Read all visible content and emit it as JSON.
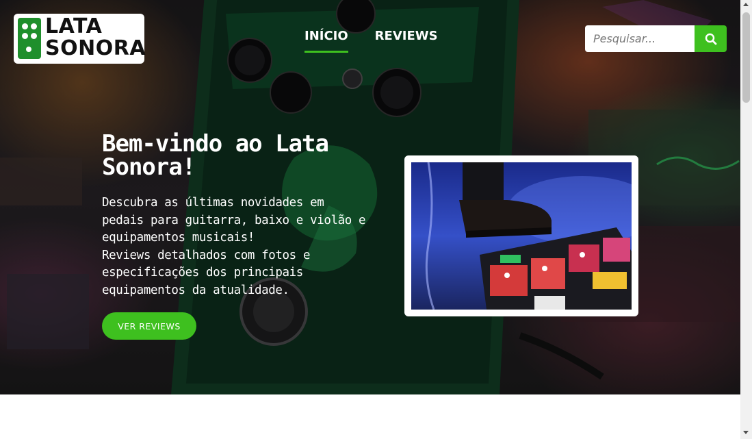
{
  "brand": {
    "line1": "LATA",
    "line2": "SONORA"
  },
  "nav": {
    "items": [
      {
        "label": "INÍCIO",
        "active": true
      },
      {
        "label": "REVIEWS",
        "active": false
      }
    ]
  },
  "search": {
    "placeholder": "Pesquisar...",
    "icon": "search-icon"
  },
  "hero": {
    "title": "Bem-vindo ao Lata Sonora!",
    "description_line1": "Descubra as últimas novidades em pedais para guitarra, baixo e violão e equipamentos musicais!",
    "description_line2": "Reviews detalhados com fotos e especificações dos principais equipamentos da atualidade.",
    "cta_label": "VER REVIEWS"
  },
  "colors": {
    "accent": "#3ec01f",
    "brand_green": "#1f8f2c"
  }
}
